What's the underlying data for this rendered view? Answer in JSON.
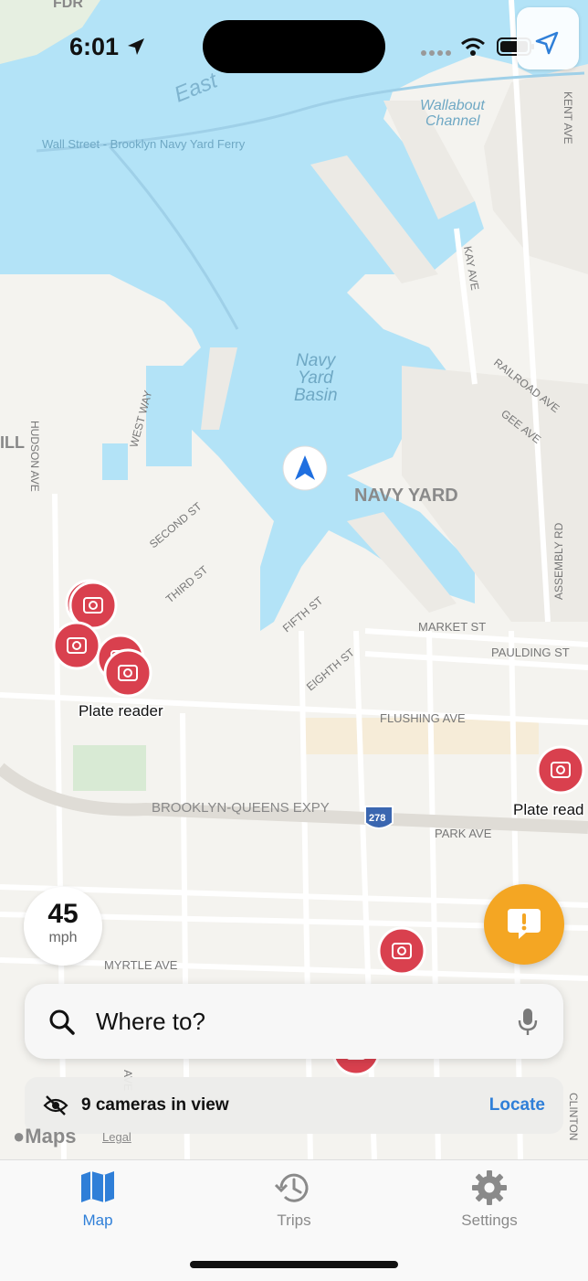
{
  "status_bar": {
    "time": "6:01"
  },
  "map": {
    "labels": {
      "east_river": "East",
      "wallabout_channel_1": "Wallabout",
      "wallabout_channel_2": "Channel",
      "ferry": "Wall Street - Brooklyn Navy Yard Ferry",
      "basin_1": "Navy",
      "basin_2": "Yard",
      "basin_3": "Basin",
      "navy_yard": "NAVY YARD",
      "hill": "ILL",
      "hudson_ave": "HUDSON AVE",
      "west_way": "WEST WAY",
      "second_st": "SECOND ST",
      "third_st": "THIRD ST",
      "fifth_st": "FIFTH ST",
      "eighth_st": "EIGHTH ST",
      "market_st": "MARKET ST",
      "paulding_st": "PAULDING ST",
      "flushing_ave": "FLUSHING AVE",
      "bqe": "BROOKLYN-QUEENS EXPY",
      "shield": "278",
      "park_ave": "PARK AVE",
      "myrtle_ave": "MYRTLE AVE",
      "kay_ave": "KAY AVE",
      "railroad_ave": "RAILROAD AVE",
      "gee_ave": "GEE AVE",
      "kent_ave": "KENT AVE",
      "assembly_rd": "ASSEMBLY RD",
      "fdr": "FDR",
      "clinton": "CLINTON",
      "lower_ave": "AVE"
    },
    "camera_label": "Plate reader",
    "camera_label_right": "Plate read",
    "attribution": "Maps",
    "legal": "Legal",
    "colors": {
      "water": "#b3e3f7",
      "land": "#f4f3ef",
      "camera": "#d9404e",
      "accent": "#2f7fd8",
      "alert": "#f4a623"
    }
  },
  "speed": {
    "value": "45",
    "unit": "mph"
  },
  "search": {
    "placeholder": "Where to?"
  },
  "camera_bar": {
    "count_text": "9 cameras in view",
    "locate_label": "Locate"
  },
  "tabs": [
    {
      "label": "Map",
      "icon": "map-icon",
      "active": true
    },
    {
      "label": "Trips",
      "icon": "history-icon",
      "active": false
    },
    {
      "label": "Settings",
      "icon": "gear-icon",
      "active": false
    }
  ]
}
